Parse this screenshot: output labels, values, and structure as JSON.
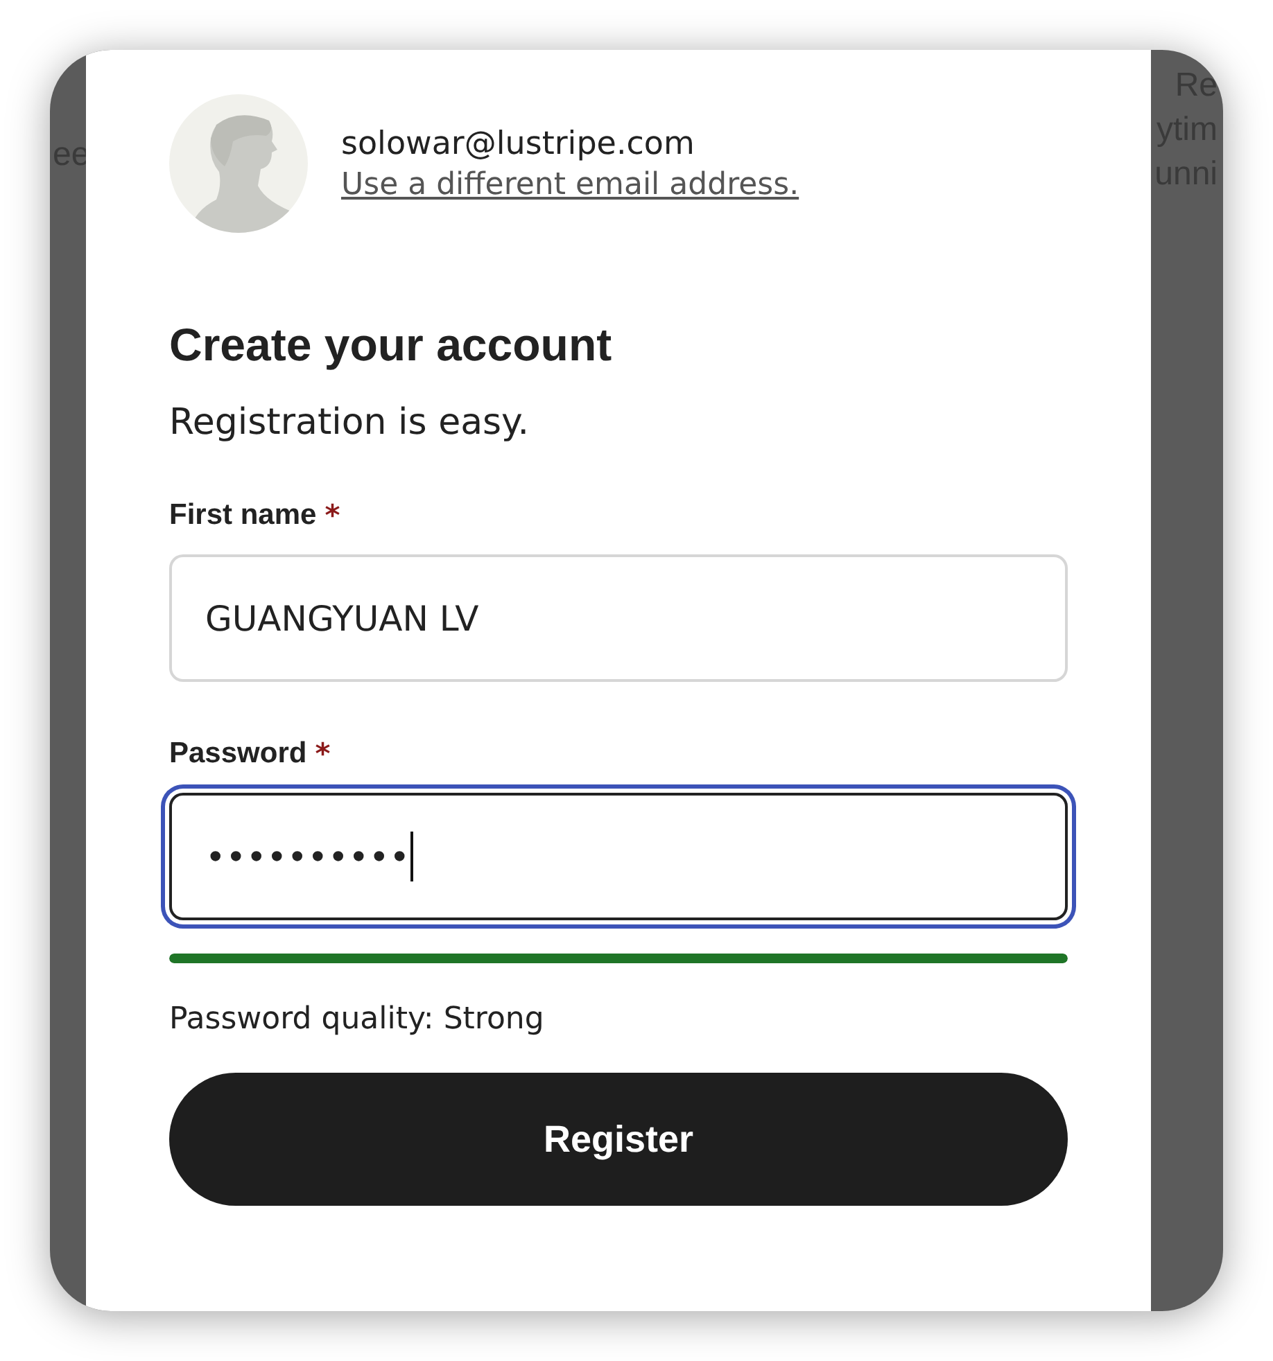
{
  "background_text": {
    "left": [
      "ee"
    ],
    "right": [
      "Re",
      "ytim",
      "unni"
    ]
  },
  "account": {
    "email": "solowar@lustripe.com",
    "change_link": "Use a different email address."
  },
  "heading": "Create your account",
  "subheading": "Registration is easy.",
  "fields": [
    {
      "label": "First name",
      "required_mark": "*",
      "value": "GUANGYUAN LV",
      "focused": false
    },
    {
      "label": "Password",
      "required_mark": "*",
      "value": "••••••••••",
      "focused": true
    }
  ],
  "strength": {
    "level": 1,
    "text": "Password quality: Strong"
  },
  "submit": "Register"
}
